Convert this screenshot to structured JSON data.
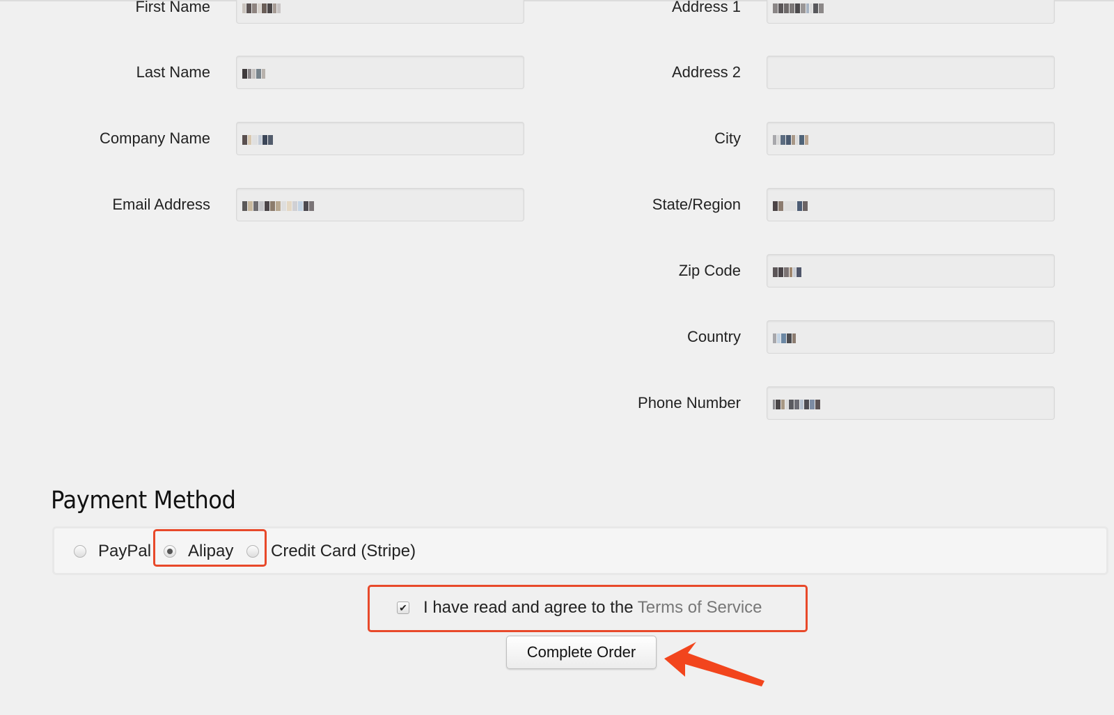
{
  "form": {
    "left_fields": [
      {
        "label": "First Name",
        "value_obscured": true,
        "value": ""
      },
      {
        "label": "Last Name",
        "value_obscured": true,
        "value": ""
      },
      {
        "label": "Company Name",
        "value_obscured": true,
        "value": ""
      },
      {
        "label": "Email Address",
        "value_obscured": true,
        "value": ""
      }
    ],
    "right_fields": [
      {
        "label": "Address 1",
        "value_obscured": true,
        "value": ""
      },
      {
        "label": "Address 2",
        "value_obscured": false,
        "value": ""
      },
      {
        "label": "City",
        "value_obscured": true,
        "value": ""
      },
      {
        "label": "State/Region",
        "value_obscured": true,
        "value": ""
      },
      {
        "label": "Zip Code",
        "value_obscured": true,
        "value": ""
      },
      {
        "label": "Country",
        "value_obscured": true,
        "value": ""
      },
      {
        "label": "Phone Number",
        "value_obscured": true,
        "value": ""
      }
    ]
  },
  "payment": {
    "title": "Payment Method",
    "options": [
      {
        "label": "PayPal",
        "checked": false
      },
      {
        "label": "Alipay",
        "checked": true
      },
      {
        "label": "Credit Card (Stripe)",
        "checked": false
      }
    ],
    "selected": "Alipay"
  },
  "terms": {
    "checked": true,
    "check_glyph": "✔",
    "prefix": "I have read and agree to the ",
    "link_label": "Terms of Service"
  },
  "actions": {
    "complete_order_label": "Complete Order"
  },
  "annotations": {
    "highlight_color": "#e8492a",
    "arrow_color": "#f2451d"
  },
  "colors": {
    "page_background": "#f0f0f0",
    "input_background": "#ececec",
    "link_text": "#777777"
  }
}
